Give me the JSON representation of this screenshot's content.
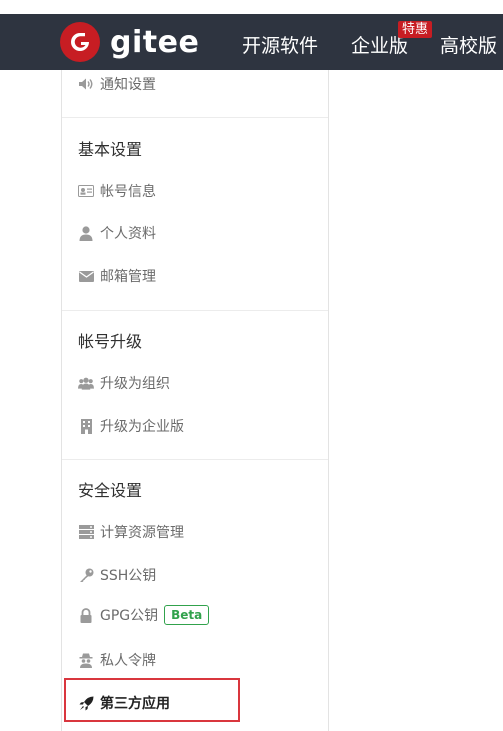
{
  "header": {
    "logo_text": "gitee",
    "nav": [
      {
        "label": "开源软件"
      },
      {
        "label": "企业版"
      },
      {
        "label": "高校版"
      }
    ],
    "promo_badge": "特惠",
    "colors": {
      "bar": "#2e3440",
      "brand": "#c71d23"
    }
  },
  "sidebar": {
    "top_item": {
      "label": "通知设置",
      "icon": "volume-icon"
    },
    "groups": [
      {
        "title": "基本设置",
        "items": [
          {
            "label": "帐号信息",
            "icon": "id-card-icon"
          },
          {
            "label": "个人资料",
            "icon": "user-icon"
          },
          {
            "label": "邮箱管理",
            "icon": "mail-icon"
          }
        ]
      },
      {
        "title": "帐号升级",
        "items": [
          {
            "label": "升级为组织",
            "icon": "users-icon"
          },
          {
            "label": "升级为企业版",
            "icon": "building-icon"
          }
        ]
      },
      {
        "title": "安全设置",
        "items": [
          {
            "label": "计算资源管理",
            "icon": "server-icon"
          },
          {
            "label": "SSH公钥",
            "icon": "key-icon"
          },
          {
            "label": "GPG公钥",
            "icon": "lock-icon",
            "badge": "Beta"
          },
          {
            "label": "私人令牌",
            "icon": "spy-icon"
          },
          {
            "label": "第三方应用",
            "icon": "rocket-icon",
            "active": true
          }
        ]
      }
    ],
    "colors": {
      "highlight": "#d9363e",
      "beta": "#31a24c"
    }
  }
}
